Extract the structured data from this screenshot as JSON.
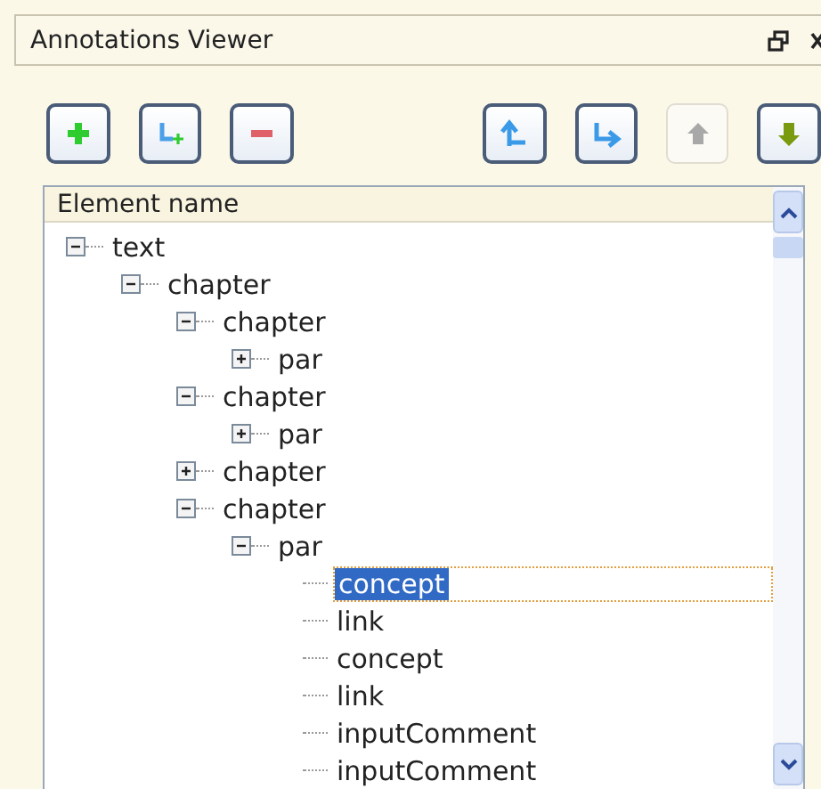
{
  "window": {
    "title": "Annotations Viewer"
  },
  "toolbar": [
    {
      "kind": "add",
      "disabled": false
    },
    {
      "kind": "add-child",
      "disabled": false
    },
    {
      "kind": "remove",
      "disabled": false
    },
    {
      "kind": "to-parent",
      "disabled": false
    },
    {
      "kind": "to-child",
      "disabled": false
    },
    {
      "kind": "move-up",
      "disabled": true
    },
    {
      "kind": "move-down",
      "disabled": false
    }
  ],
  "tree": {
    "column": "Element name",
    "nodes": [
      {
        "label": "text",
        "kind": "branch",
        "expanded": true,
        "selected": false,
        "children": [
          {
            "label": "chapter",
            "kind": "branch",
            "expanded": true,
            "selected": false,
            "children": [
              {
                "label": "chapter",
                "kind": "branch",
                "expanded": true,
                "selected": false,
                "children": [
                  {
                    "label": "par",
                    "kind": "branch",
                    "expanded": false,
                    "selected": false
                  }
                ]
              },
              {
                "label": "chapter",
                "kind": "branch",
                "expanded": true,
                "selected": false,
                "children": [
                  {
                    "label": "par",
                    "kind": "branch",
                    "expanded": false,
                    "selected": false
                  }
                ]
              },
              {
                "label": "chapter",
                "kind": "branch",
                "expanded": false,
                "selected": false
              },
              {
                "label": "chapter",
                "kind": "branch",
                "expanded": true,
                "selected": false,
                "children": [
                  {
                    "label": "par",
                    "kind": "branch",
                    "expanded": true,
                    "selected": false,
                    "children": [
                      {
                        "label": "concept",
                        "kind": "leaf",
                        "selected": true
                      },
                      {
                        "label": "link",
                        "kind": "leaf",
                        "selected": false
                      },
                      {
                        "label": "concept",
                        "kind": "leaf",
                        "selected": false
                      },
                      {
                        "label": "link",
                        "kind": "leaf",
                        "selected": false
                      },
                      {
                        "label": "inputComment",
                        "kind": "leaf",
                        "selected": false
                      },
                      {
                        "label": "inputComment",
                        "kind": "leaf",
                        "selected": false
                      }
                    ]
                  }
                ]
              }
            ]
          }
        ]
      }
    ]
  }
}
